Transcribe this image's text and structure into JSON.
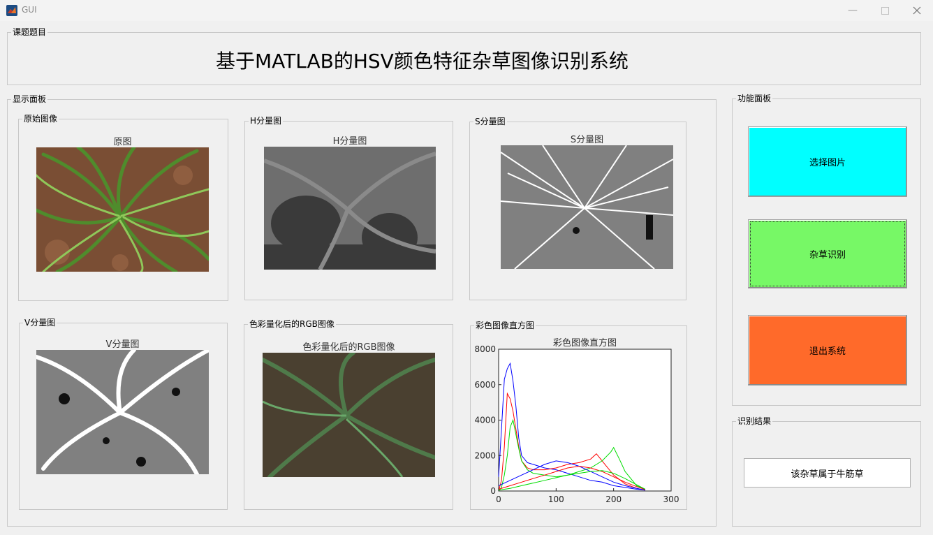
{
  "window": {
    "title": "GUI",
    "icon": "matlab-logo-icon"
  },
  "title_panel": {
    "legend": "课题题目",
    "title": "基于MATLAB的HSV颜色特征杂草图像识别系统"
  },
  "display_panel": {
    "legend": "显示面板",
    "original": {
      "legend": "原始图像",
      "axes_title": "原图"
    },
    "h": {
      "legend": "H分量图",
      "axes_title": "H分量图"
    },
    "s": {
      "legend": "S分量图",
      "axes_title": "S分量图"
    },
    "v": {
      "legend": "V分量图",
      "axes_title": "V分量图"
    },
    "quant": {
      "legend": "色彩量化后的RGB图像",
      "axes_title": "色彩量化后的RGB图像"
    },
    "hist": {
      "legend": "彩色图像直方图",
      "axes_title": "彩色图像直方图"
    }
  },
  "function_panel": {
    "legend": "功能面板",
    "buttons": [
      {
        "label": "选择图片",
        "color": "#00ffff"
      },
      {
        "label": "杂草识别",
        "color": "#77f866"
      },
      {
        "label": "退出系统",
        "color": "#ff6a2a"
      }
    ]
  },
  "result_panel": {
    "legend": "识别结果",
    "value": "该杂草属于牛筋草"
  },
  "chart_data": {
    "type": "line",
    "title": "彩色图像直方图",
    "xlim": [
      0,
      300
    ],
    "ylim": [
      0,
      8000
    ],
    "xticks": [
      0,
      100,
      200,
      300
    ],
    "yticks": [
      0,
      2000,
      4000,
      6000,
      8000
    ],
    "series": [
      {
        "color": "#0000ff",
        "x": [
          0,
          5,
          10,
          15,
          20,
          25,
          30,
          35,
          40,
          50,
          60,
          80,
          100,
          120,
          140,
          160,
          180,
          200,
          220,
          240,
          255
        ],
        "y": [
          800,
          3500,
          6300,
          6900,
          7200,
          6200,
          4800,
          3000,
          2000,
          1600,
          1500,
          1300,
          1200,
          1000,
          800,
          600,
          500,
          300,
          200,
          100,
          50
        ]
      },
      {
        "color": "#ff0000",
        "x": [
          0,
          5,
          10,
          15,
          20,
          25,
          30,
          35,
          40,
          50,
          60,
          80,
          100,
          120,
          140,
          160,
          170,
          180,
          200,
          220,
          240,
          255
        ],
        "y": [
          0,
          600,
          2500,
          5500,
          5200,
          4500,
          3500,
          2500,
          1700,
          1300,
          1200,
          1200,
          1300,
          1500,
          1600,
          1800,
          2100,
          1700,
          900,
          400,
          150,
          50
        ]
      },
      {
        "color": "#00dd00",
        "x": [
          0,
          5,
          10,
          15,
          20,
          25,
          30,
          35,
          40,
          50,
          60,
          80,
          100,
          120,
          140,
          160,
          180,
          195,
          200,
          210,
          220,
          240,
          255
        ],
        "y": [
          0,
          200,
          900,
          2000,
          3600,
          4000,
          3200,
          2400,
          1700,
          1200,
          1000,
          900,
          800,
          900,
          1100,
          1300,
          1700,
          2200,
          2450,
          1800,
          1100,
          300,
          100
        ]
      },
      {
        "color": "#0000ff",
        "x": [
          0,
          20,
          40,
          60,
          80,
          100,
          120,
          140,
          160,
          180,
          200,
          220,
          240,
          255
        ],
        "y": [
          300,
          600,
          900,
          1200,
          1500,
          1700,
          1600,
          1400,
          1100,
          800,
          500,
          300,
          150,
          50
        ]
      },
      {
        "color": "#ff0000",
        "x": [
          0,
          20,
          40,
          60,
          80,
          100,
          120,
          140,
          160,
          180,
          200,
          220,
          240,
          255
        ],
        "y": [
          100,
          300,
          500,
          700,
          900,
          1100,
          1300,
          1400,
          1300,
          1100,
          800,
          500,
          250,
          80
        ]
      },
      {
        "color": "#00dd00",
        "x": [
          0,
          20,
          40,
          60,
          80,
          100,
          120,
          140,
          160,
          180,
          200,
          220,
          240,
          255
        ],
        "y": [
          50,
          150,
          300,
          450,
          600,
          750,
          900,
          1000,
          1100,
          1150,
          1000,
          700,
          350,
          100
        ]
      }
    ]
  }
}
